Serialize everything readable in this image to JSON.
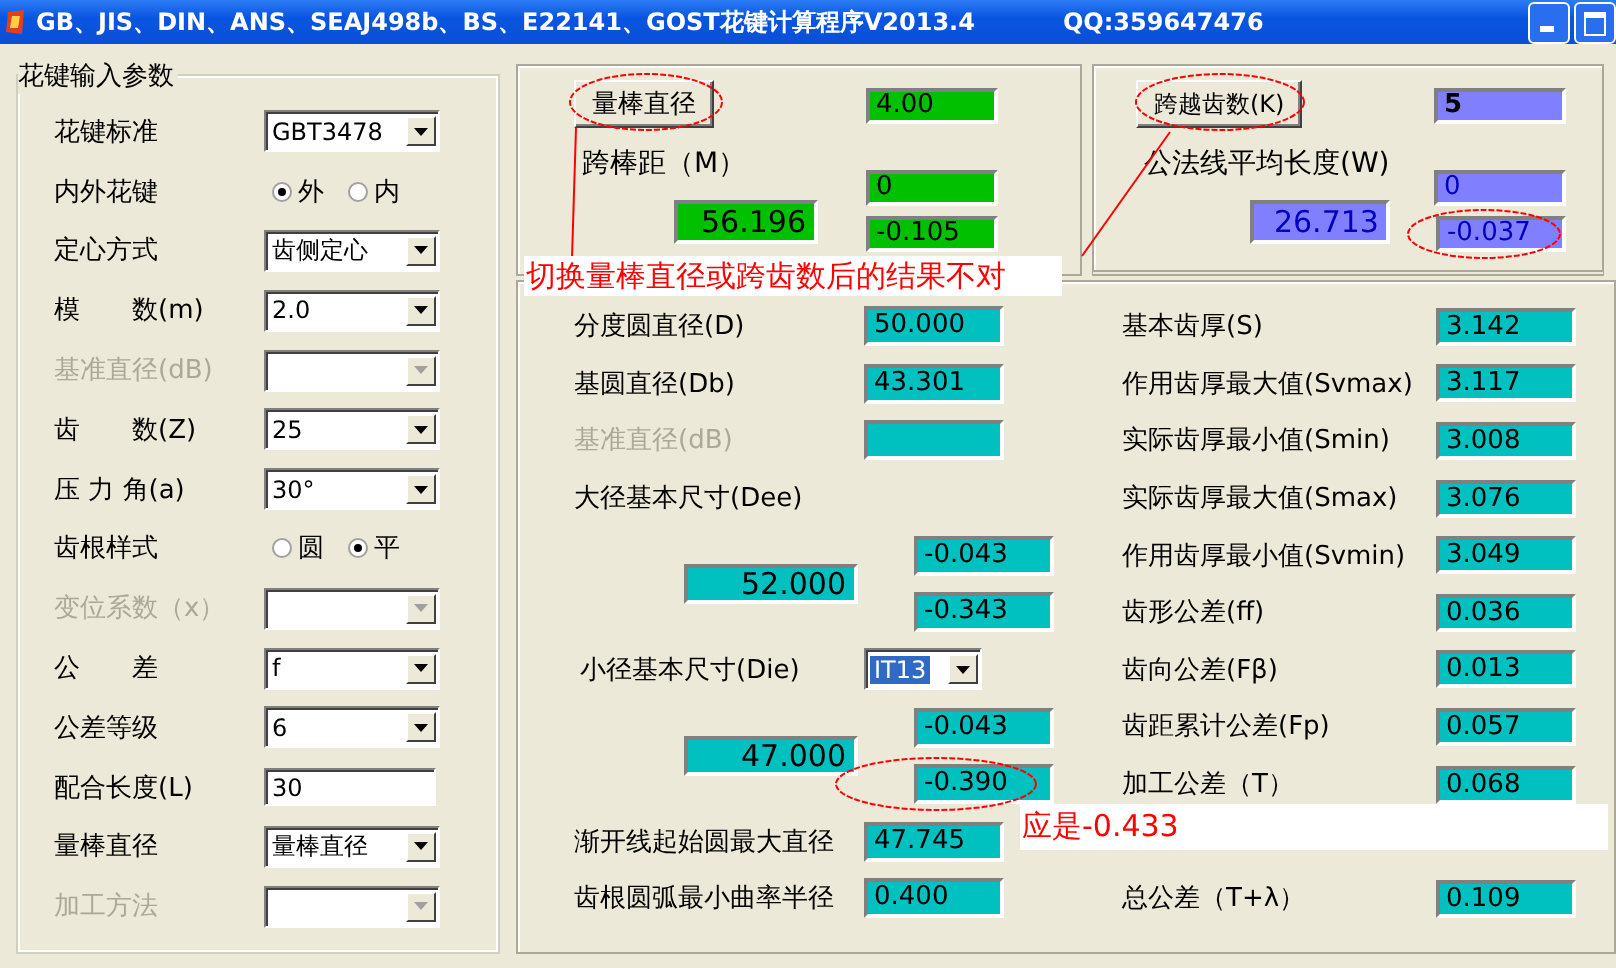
{
  "window": {
    "title": "GB、JIS、DIN、ANS、SEAJ498b、BS、E22141、GOST花键计算程序V2013.4",
    "qq": "QQ:359647476"
  },
  "input_group": {
    "title": "花键输入参数",
    "rows": [
      {
        "kind": "select",
        "label": "花键标准",
        "value": "GBT3478",
        "disabled": false
      },
      {
        "kind": "radio",
        "label": "内外花键",
        "options": [
          {
            "label": "外",
            "selected": true
          },
          {
            "label": "内",
            "selected": false
          }
        ]
      },
      {
        "kind": "select",
        "label": "定心方式",
        "value": "齿侧定心",
        "disabled": false
      },
      {
        "kind": "select",
        "label": "模　　数(m)",
        "value": "2.0",
        "disabled": false
      },
      {
        "kind": "select",
        "label": "基准直径(dB)",
        "disabled": true
      },
      {
        "kind": "select",
        "label": "齿　　数(Z)",
        "value": "25",
        "disabled": false
      },
      {
        "kind": "select",
        "label": "压 力 角(a)",
        "value": "30°",
        "disabled": false
      },
      {
        "kind": "radio",
        "label": "齿根样式",
        "options": [
          {
            "label": "圆",
            "selected": false
          },
          {
            "label": "平",
            "selected": true
          }
        ]
      },
      {
        "kind": "select",
        "label": "变位系数（x）",
        "disabled": true
      },
      {
        "kind": "select",
        "label": "公　　差",
        "value": "f",
        "disabled": false
      },
      {
        "kind": "select",
        "label": "公差等级",
        "value": "6",
        "disabled": false
      },
      {
        "kind": "input",
        "label": "配合长度(L)",
        "value": "30",
        "disabled": false
      },
      {
        "kind": "select",
        "label": "量棒直径",
        "value": "量棒直径",
        "disabled": false
      },
      {
        "kind": "select",
        "label": "加工方法",
        "disabled": true
      }
    ]
  },
  "pin_panel": {
    "button": "量棒直径",
    "input": "4.00",
    "label": "跨棒距（M）",
    "result": "56.196",
    "upper": "0",
    "lower": "-0.105",
    "color": "#00c000"
  },
  "span_panel": {
    "button": "跨越齿数(K)",
    "input": "5",
    "label": "公法线平均长度(W)",
    "result": "26.713",
    "upper": "0",
    "lower": "-0.037",
    "color": "#8080ff"
  },
  "results": {
    "left": [
      {
        "kind": "field",
        "label": "分度圆直径(D)",
        "value": "50.000"
      },
      {
        "kind": "field",
        "label": "基圆直径(Db)",
        "value": "43.301"
      },
      {
        "kind": "field",
        "label": "基准直径(dB)",
        "disabled": true
      },
      {
        "kind": "label",
        "label": "大径基本尺寸(Dee)"
      },
      {
        "kind": "tolerance",
        "value": "52.000",
        "upper": "-0.043",
        "lower": "-0.343"
      },
      {
        "kind": "select",
        "label": "小径基本尺寸(Die)",
        "value": "IT13"
      },
      {
        "kind": "tolerance",
        "value": "47.000",
        "upper": "-0.043",
        "lower": "-0.390"
      },
      {
        "kind": "field",
        "label": "渐开线起始圆最大直径",
        "value": "47.745"
      },
      {
        "kind": "field",
        "label": "齿根圆弧最小曲率半径",
        "value": "0.400"
      }
    ],
    "right": [
      {
        "label": "基本齿厚(S)",
        "value": "3.142"
      },
      {
        "label": "作用齿厚最大值(Svmax)",
        "value": "3.117"
      },
      {
        "label": "实际齿厚最小值(Smin)",
        "value": "3.008"
      },
      {
        "label": "实际齿厚最大值(Smax)",
        "value": "3.076"
      },
      {
        "label": "作用齿厚最小值(Svmin)",
        "value": "3.049"
      },
      {
        "label": "齿形公差(ff)",
        "value": "0.036"
      },
      {
        "label": "齿向公差(Fβ)",
        "value": "0.013"
      },
      {
        "label": "齿距累计公差(Fp)",
        "value": "0.057"
      },
      {
        "label": "加工公差（T）",
        "value": "0.068"
      },
      {
        "label": "总公差（T+λ）",
        "value": "0.109"
      }
    ]
  },
  "annotations": [
    {
      "text": "切换量棒直径或跨齿数后的结果不对"
    },
    {
      "text": "应是-0.433"
    }
  ]
}
